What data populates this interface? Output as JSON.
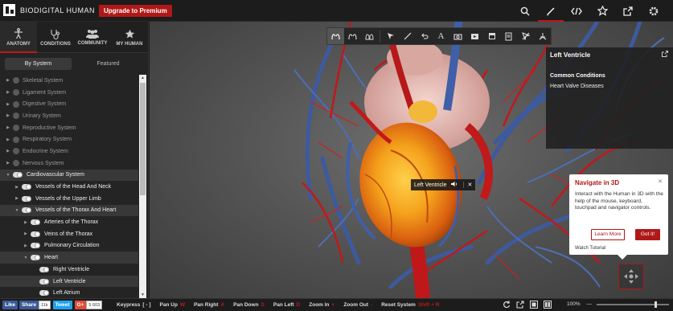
{
  "app": {
    "name": "BIODIGITAL HUMAN",
    "premium_label": "Upgrade to Premium"
  },
  "top_icons": [
    "search-icon",
    "pencil-icon",
    "embed-code-icon",
    "star-icon",
    "share-icon",
    "gear-icon"
  ],
  "sidebar": {
    "tabs": [
      {
        "label": "ANATOMY",
        "icon": "human-figure-icon",
        "active": true
      },
      {
        "label": "CONDITIONS",
        "icon": "stethoscope-icon",
        "active": false
      },
      {
        "label": "COMMUNITY",
        "icon": "people-icon",
        "active": false
      },
      {
        "label": "MY HUMAN",
        "icon": "star-icon",
        "active": false
      }
    ],
    "subtabs": [
      {
        "label": "By System",
        "active": true
      },
      {
        "label": "Featured",
        "active": false
      }
    ],
    "tree": [
      {
        "label": "Skeletal System",
        "depth": 0,
        "state": "off",
        "caret": "right"
      },
      {
        "label": "Ligament System",
        "depth": 0,
        "state": "off",
        "caret": "right"
      },
      {
        "label": "Digestive System",
        "depth": 0,
        "state": "off",
        "caret": "right"
      },
      {
        "label": "Urinary System",
        "depth": 0,
        "state": "off",
        "caret": "right"
      },
      {
        "label": "Reproductive System",
        "depth": 0,
        "state": "off",
        "caret": "right"
      },
      {
        "label": "Respiratory System",
        "depth": 0,
        "state": "off",
        "caret": "right"
      },
      {
        "label": "Endocrine System",
        "depth": 0,
        "state": "off",
        "caret": "right"
      },
      {
        "label": "Nervous System",
        "depth": 0,
        "state": "off",
        "caret": "right"
      },
      {
        "label": "Cardiovascular System",
        "depth": 0,
        "state": "on",
        "caret": "down",
        "highlight": true
      },
      {
        "label": "Vessels of the Head And Neck",
        "depth": 1,
        "state": "on",
        "caret": "right"
      },
      {
        "label": "Vessels of the Upper Limb",
        "depth": 1,
        "state": "on",
        "caret": "right"
      },
      {
        "label": "Vessels of the Thorax And Heart",
        "depth": 1,
        "state": "on",
        "caret": "down",
        "highlight": true
      },
      {
        "label": "Arteries of the Thorax",
        "depth": 2,
        "state": "on",
        "caret": "right"
      },
      {
        "label": "Veins of the Thorax",
        "depth": 2,
        "state": "on",
        "caret": "right"
      },
      {
        "label": "Pulmonary Circulation",
        "depth": 2,
        "state": "on",
        "caret": "right"
      },
      {
        "label": "Heart",
        "depth": 2,
        "state": "on",
        "caret": "down",
        "highlight": true
      },
      {
        "label": "Right Ventricle",
        "depth": 3,
        "state": "on",
        "caret": ""
      },
      {
        "label": "Left Ventricle",
        "depth": 3,
        "state": "on",
        "caret": "",
        "highlight": true
      },
      {
        "label": "Left Atrium",
        "depth": 3,
        "state": "on",
        "caret": ""
      }
    ]
  },
  "viewport": {
    "toolbar": [
      "anatomy-view-icon",
      "lungs-icon",
      "lungs-outline-icon",
      "pointer-icon",
      "pen-icon",
      "undo-icon",
      "text-icon",
      "camera-icon",
      "video-icon",
      "window-icon",
      "document-icon",
      "no-fly-icon",
      "person-icon"
    ],
    "info": {
      "title": "Left Ventricle",
      "section": "Common Conditions",
      "condition": "Heart Valve Diseases"
    },
    "label": {
      "text": "Left Ventricle"
    },
    "popup": {
      "title": "Navigate in 3D",
      "body": "Interact with the Human in 3D with the help of the mouse, keyboard, touchpad and navigator controls.",
      "learn_more": "Learn More",
      "got_it": "Got it!",
      "watch": "Watch Tutorial"
    }
  },
  "bottom": {
    "social": {
      "fb_like": "Like",
      "fb_share": "Share",
      "fb_count": "11k",
      "tweet": "Tweet",
      "gplus": "G+",
      "gplus_count": "5 603"
    },
    "keys": [
      {
        "label": "Keypress",
        "key": "[ - ]"
      },
      {
        "label": "Pan Up",
        "key": "W"
      },
      {
        "label": "Pan Right",
        "key": "A"
      },
      {
        "label": "Pan Down",
        "key": "S"
      },
      {
        "label": "Pan Left",
        "key": "D"
      },
      {
        "label": "Zoom In",
        "key": "+"
      },
      {
        "label": "Zoom Out",
        "key": "-"
      },
      {
        "label": "Reset System",
        "key": "Shift + R"
      }
    ],
    "zoom_label": "100%",
    "zoom_level": 0.8,
    "accent": "#c01818"
  }
}
